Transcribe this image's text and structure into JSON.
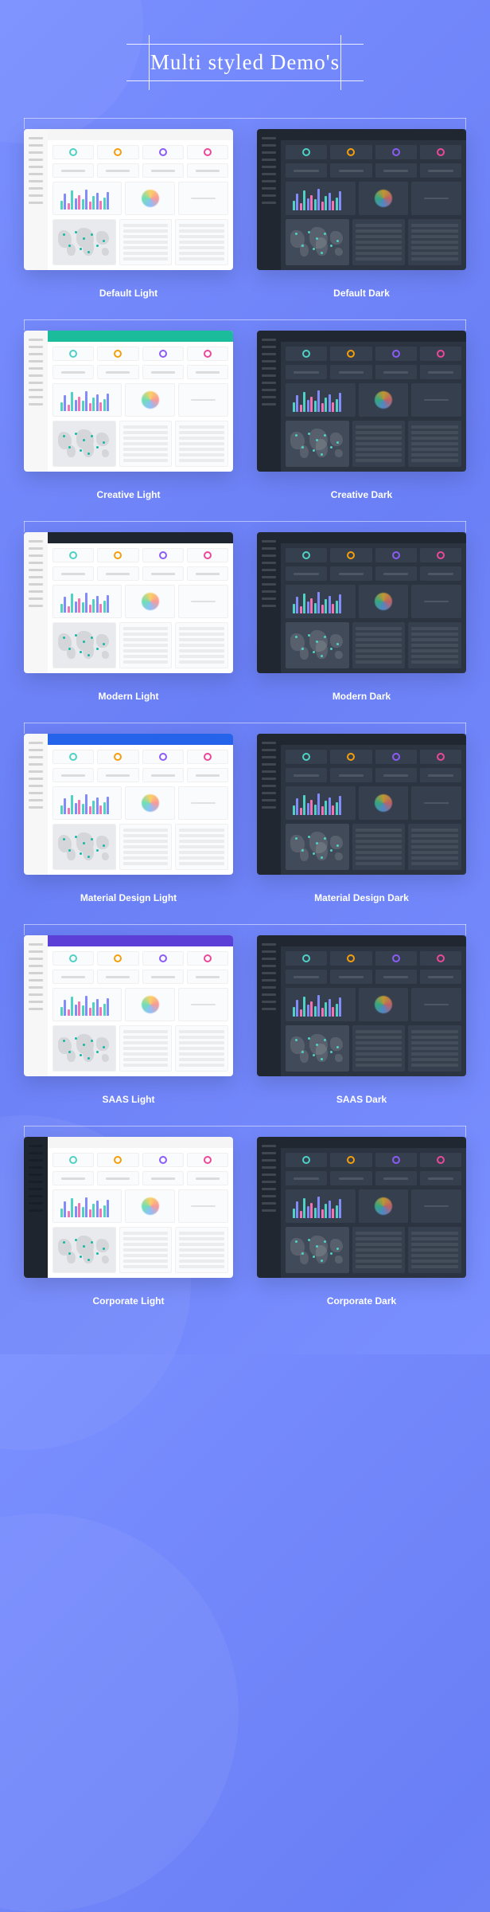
{
  "title": "Multi styled Demo's",
  "demos": [
    {
      "label": "Default Light",
      "variant": "light",
      "accent": "none"
    },
    {
      "label": "Default Dark",
      "variant": "dark",
      "accent": "none"
    },
    {
      "label": "Creative Light",
      "variant": "light",
      "accent": "teal"
    },
    {
      "label": "Creative Dark",
      "variant": "dark",
      "accent": "none"
    },
    {
      "label": "Modern Light",
      "variant": "light",
      "accent": "black"
    },
    {
      "label": "Modern Dark",
      "variant": "dark",
      "accent": "none"
    },
    {
      "label": "Material Design Light",
      "variant": "light",
      "accent": "blue"
    },
    {
      "label": "Material Design Dark",
      "variant": "dark",
      "accent": "none"
    },
    {
      "label": "SAAS Light",
      "variant": "light",
      "accent": "purple"
    },
    {
      "label": "SAAS Dark",
      "variant": "dark",
      "accent": "none"
    },
    {
      "label": "Corporate Light",
      "variant": "light",
      "accent": "sidedark"
    },
    {
      "label": "Corporate Dark",
      "variant": "dark",
      "accent": "none"
    }
  ]
}
